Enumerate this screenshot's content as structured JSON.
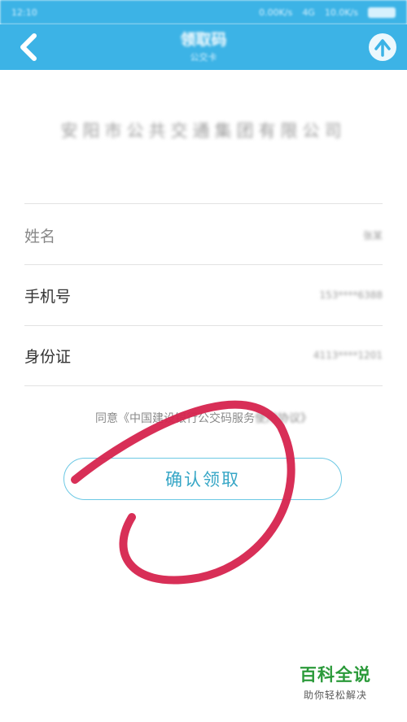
{
  "status_bar": {
    "time": "12:10",
    "network": "0.00K/s",
    "signal": "4G",
    "speed": "10.0K/s"
  },
  "header": {
    "title": "领取码",
    "subtitle": "公交卡"
  },
  "company": "安阳市公共交通集团有限公司",
  "form": {
    "rows": [
      {
        "label": "姓名",
        "value": "张某"
      },
      {
        "label": "手机号",
        "value": "153****6388"
      },
      {
        "label": "身份证",
        "value": "4113****1201"
      }
    ]
  },
  "agreement": {
    "prefix": "同意《中国建设银行公交码服务",
    "rest": "使用协议》"
  },
  "confirm_button": "确认领取",
  "watermark": {
    "title": "百科全说",
    "subtitle": "助你轻松解决"
  },
  "colors": {
    "header_bg": "#3cb3e6",
    "button_text": "#36a6c6",
    "annotation_circle": "#d6244e"
  }
}
